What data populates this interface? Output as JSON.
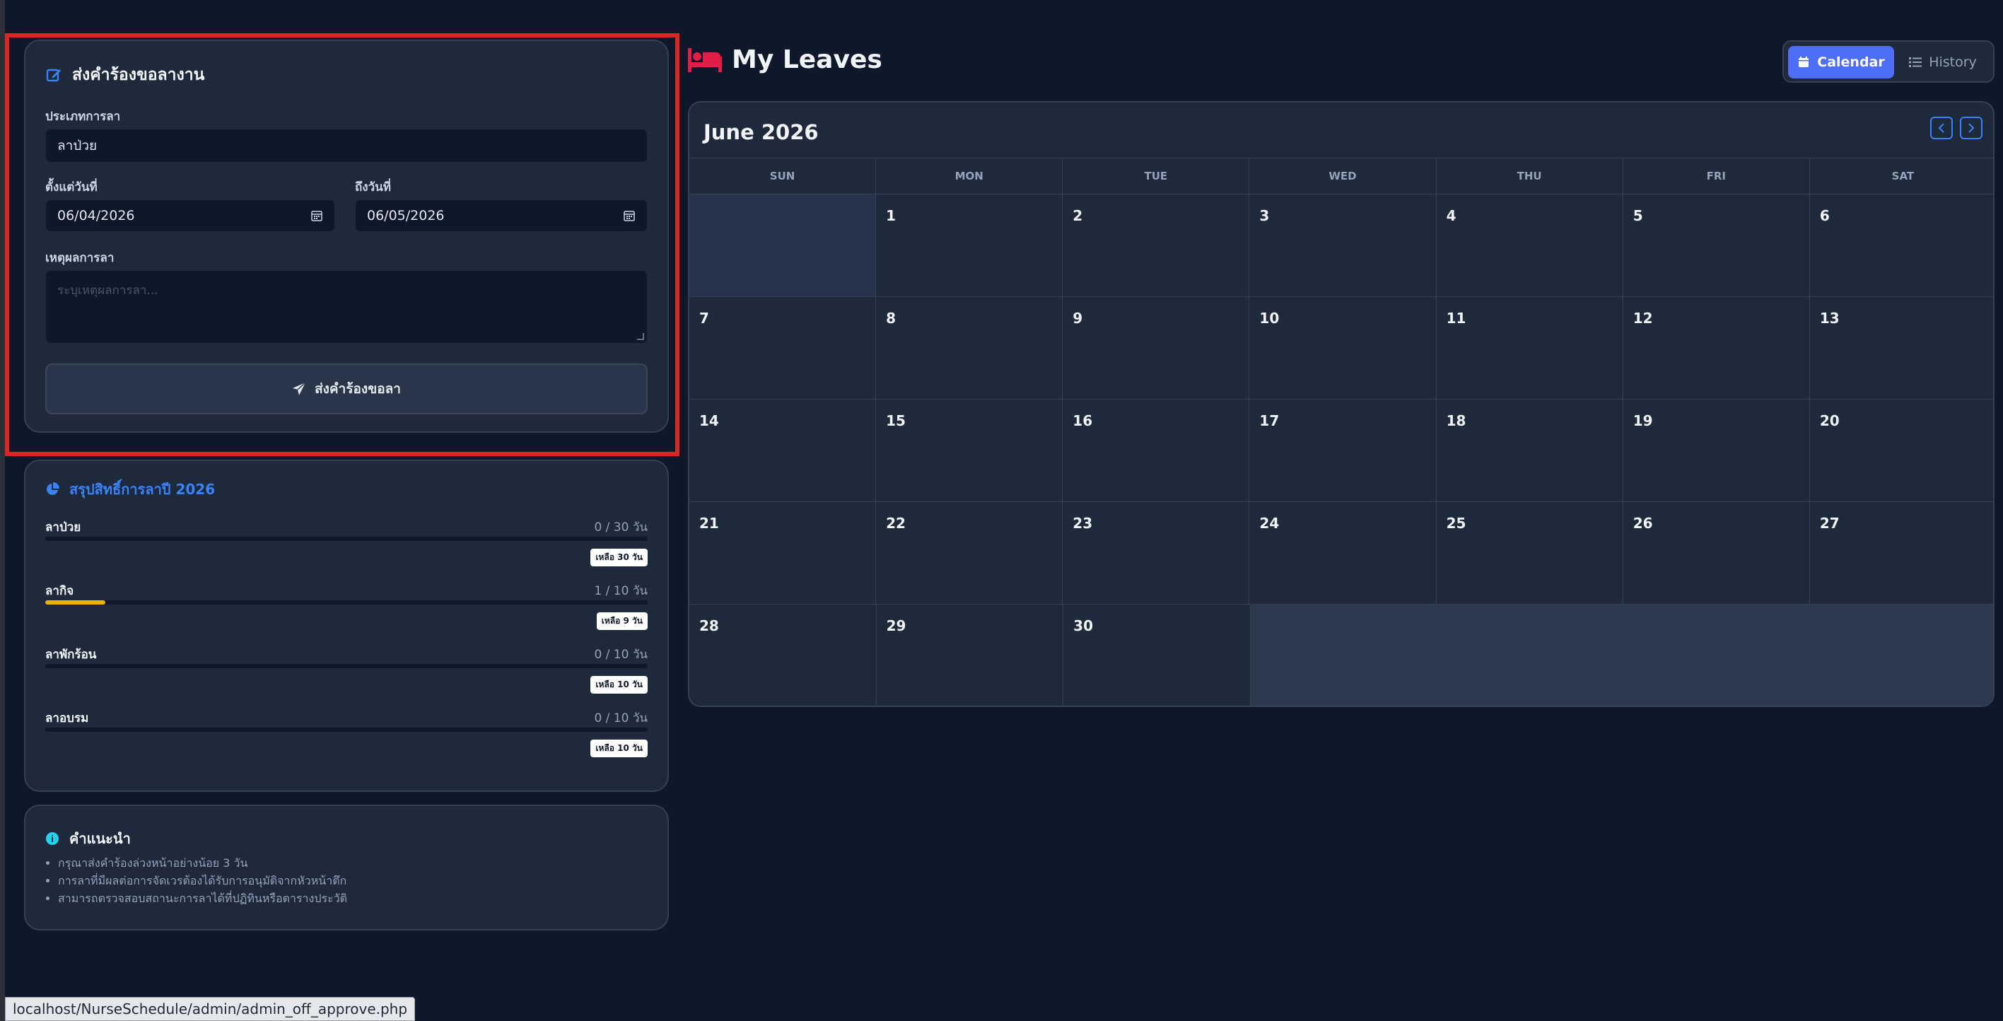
{
  "form": {
    "title": "ส่งคำร้องขอลางาน",
    "leave_type_label": "ประเภทการลา",
    "leave_type_value": "ลาป่วย",
    "start_label": "ตั้งแต่วันที่",
    "start_value": "06/04/2026",
    "end_label": "ถึงวันที่",
    "end_value": "06/05/2026",
    "reason_label": "เหตุผลการลา",
    "reason_placeholder": "ระบุเหตุผลการลา...",
    "submit_label": "ส่งคำร้องขอลา"
  },
  "summary": {
    "title": "สรุปสิทธิ์การลาปี 2026",
    "accent_color": "#3b82f6",
    "progress_color": "#eab308",
    "items": [
      {
        "name": "ลาป่วย",
        "count": "0 / 30 วัน",
        "used": 0,
        "total": 30,
        "remaining": "เหลือ 30 วัน"
      },
      {
        "name": "ลากิจ",
        "count": "1 / 10 วัน",
        "used": 1,
        "total": 10,
        "remaining": "เหลือ 9 วัน"
      },
      {
        "name": "ลาพักร้อน",
        "count": "0 / 10 วัน",
        "used": 0,
        "total": 10,
        "remaining": "เหลือ 10 วัน"
      },
      {
        "name": "ลาอบรม",
        "count": "0 / 10 วัน",
        "used": 0,
        "total": 10,
        "remaining": "เหลือ 10 วัน"
      }
    ]
  },
  "tips": {
    "title": "คำแนะนำ",
    "items": [
      "กรุณาส่งคำร้องล่วงหน้าอย่างน้อย 3 วัน",
      "การลาที่มีผลต่อการจัดเวรต้องได้รับการอนุมัติจากหัวหน้าตึก",
      "สามารถตรวจสอบสถานะการลาได้ที่ปฏิทินหรือตารางประวัติ"
    ]
  },
  "header": {
    "title": "My Leaves",
    "title_icon": "bed-icon",
    "title_icon_color": "#e11d48",
    "view_calendar_label": "Calendar",
    "view_history_label": "History",
    "active_color": "#4f6ef7"
  },
  "calendar": {
    "month_title": "June 2026",
    "weekdays": [
      "SUN",
      "MON",
      "TUE",
      "WED",
      "THU",
      "FRI",
      "SAT"
    ],
    "weeks": [
      [
        "",
        "1",
        "2",
        "3",
        "4",
        "5",
        "6"
      ],
      [
        "7",
        "8",
        "9",
        "10",
        "11",
        "12",
        "13"
      ],
      [
        "14",
        "15",
        "16",
        "17",
        "18",
        "19",
        "20"
      ],
      [
        "21",
        "22",
        "23",
        "24",
        "25",
        "26",
        "27"
      ],
      [
        "28",
        "29",
        "30",
        "",
        "",
        "",
        ""
      ]
    ]
  },
  "status_bar": {
    "url": "localhost/NurseSchedule/admin/admin_off_approve.php"
  },
  "highlight_color": "#dc2626"
}
